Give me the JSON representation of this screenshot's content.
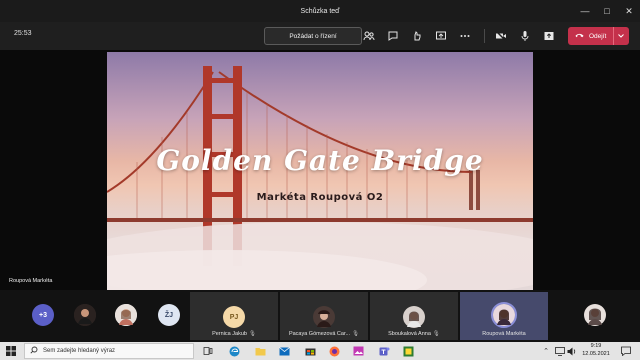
{
  "window": {
    "title": "Schůzka teď"
  },
  "toolbar": {
    "timer": "25:53",
    "request_control_label": "Požádat o řízení",
    "leave_label": "Odejít"
  },
  "slide": {
    "title": "Golden Gate Bridge",
    "subtitle": "Markéta Roupová O2",
    "presenter": "Roupová Markéta"
  },
  "participants": {
    "overflow_count": "+3",
    "initials_zj": "ŽJ",
    "tiles": [
      {
        "initials": "PJ",
        "name": "Pernica Jakub"
      },
      {
        "name": "Pacaya Gómezová Car..."
      },
      {
        "name": "Sboukalová Anna"
      },
      {
        "name": "Roupová Markéta"
      }
    ]
  },
  "taskbar": {
    "search_placeholder": "Sem zadejte hledaný výraz",
    "time": "9:19",
    "date": "12.05.2021"
  },
  "colors": {
    "leave": "#c4314b",
    "active_tile": "#464a6c",
    "pj_avatar": "#f5d9a8"
  }
}
